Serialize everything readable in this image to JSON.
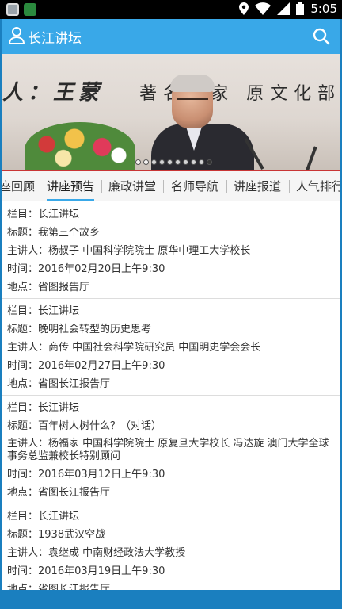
{
  "status_bar": {
    "time": "5:05",
    "icons": [
      "app-icon",
      "changjiang-app-icon",
      "location-icon",
      "wifi-icon",
      "signal-icon",
      "battery-icon"
    ]
  },
  "app_bar": {
    "title": "长江讲坛"
  },
  "banner": {
    "caption_name": "人：王蒙",
    "caption_rest": "著名作家 原文化部长"
  },
  "tabs": [
    "座回顾",
    "讲座预告",
    "廉政讲堂",
    "名师导航",
    "讲座报道",
    "人气排行"
  ],
  "lectures": [
    {
      "column": "栏目：长江讲坛",
      "title": "标题：我第三个故乡",
      "speaker": "主讲人：杨叔子 中国科学院院士 原华中理工大学校长",
      "time": "时间：2016年02月20日上午9:30",
      "place": "地点：省图报告厅"
    },
    {
      "column": "栏目：长江讲坛",
      "title": "标题：晚明社会转型的历史思考",
      "speaker": "主讲人：商传 中国社会科学院研究员 中国明史学会会长",
      "time": "时间：2016年02月27日上午9:30",
      "place": "地点：省图长江报告厅"
    },
    {
      "column": "栏目：长江讲坛",
      "title": "标题：百年树人树什么？（对话）",
      "speaker": "主讲人：杨福家 中国科学院院士 原复旦大学校长 冯达旋 澳门大学全球事务总监兼校长特别顾问",
      "time": "时间：2016年03月12日上午9:30",
      "place": "地点：省图长江报告厅"
    },
    {
      "column": "栏目：长江讲坛",
      "title": "标题：1938武汉空战",
      "speaker": "主讲人：袁继成 中南财经政法大学教授",
      "time": "时间：2016年03月19日上午9:30",
      "place": "地点：省图长江报告厅"
    }
  ]
}
